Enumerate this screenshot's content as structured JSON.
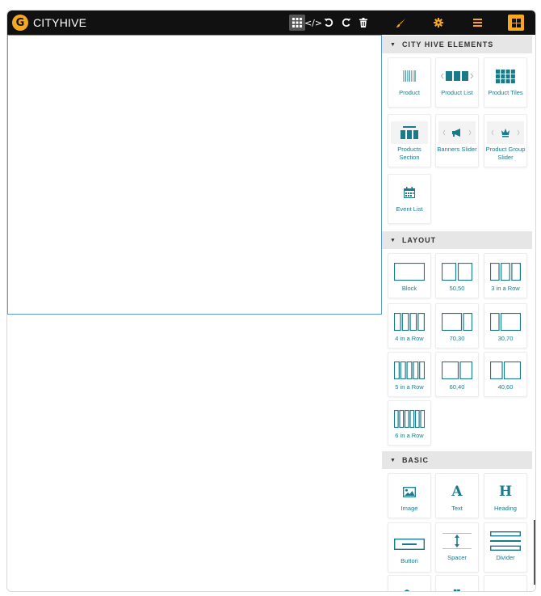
{
  "app": {
    "logo_letter": "G",
    "name": "CITYHIVE"
  },
  "toolbar": {
    "grid_icon": "grid-icon",
    "code_label": "</>",
    "undo_icon": "undo-icon",
    "redo_icon": "redo-icon",
    "trash_icon": "trash-icon",
    "brush_icon": "brush-icon",
    "gear_icon": "gear-icon",
    "menu_icon": "menu-icon",
    "blocks_icon": "blocks-icon"
  },
  "colors": {
    "accent": "#f7a823",
    "teal": "#1b7a8a",
    "topbar": "#111111",
    "selection_border": "#5b9bd5"
  },
  "sections": {
    "elements": {
      "title": "CITY HIVE ELEMENTS",
      "items": [
        {
          "label": "Product",
          "icon": "barcode-icon"
        },
        {
          "label": "Product List",
          "icon": "product-list-icon"
        },
        {
          "label": "Product Tiles",
          "icon": "product-tiles-icon"
        },
        {
          "label": "Products Section",
          "icon": "products-section-icon"
        },
        {
          "label": "Banners Slider",
          "icon": "megaphone-slider-icon"
        },
        {
          "label": "Product Group Slider",
          "icon": "crown-slider-icon"
        },
        {
          "label": "Event List",
          "icon": "calendar-icon"
        }
      ]
    },
    "layout": {
      "title": "LAYOUT",
      "items": [
        {
          "label": "Block",
          "icon": "block-layout-icon"
        },
        {
          "label": "50,50",
          "icon": "two-col-layout-icon"
        },
        {
          "label": "3 in a Row",
          "icon": "three-col-layout-icon"
        },
        {
          "label": "4 in a Row",
          "icon": "four-col-layout-icon"
        },
        {
          "label": "70,30",
          "icon": "seventy-thirty-layout-icon"
        },
        {
          "label": "30,70",
          "icon": "thirty-seventy-layout-icon"
        },
        {
          "label": "5 in a Row",
          "icon": "five-col-layout-icon"
        },
        {
          "label": "60,40",
          "icon": "sixty-forty-layout-icon"
        },
        {
          "label": "40,60",
          "icon": "forty-sixty-layout-icon"
        },
        {
          "label": "6 in a Row",
          "icon": "six-col-layout-icon"
        }
      ]
    },
    "basic": {
      "title": "BASIC",
      "items": [
        {
          "label": "Image",
          "icon": "image-icon"
        },
        {
          "label": "Text",
          "icon": "text-icon",
          "glyph": "A"
        },
        {
          "label": "Heading",
          "icon": "heading-icon",
          "glyph": "H"
        },
        {
          "label": "Button",
          "icon": "button-icon"
        },
        {
          "label": "Spacer",
          "icon": "spacer-icon"
        },
        {
          "label": "Divider",
          "icon": "divider-icon"
        },
        {
          "label": "",
          "icon": "link-icon"
        },
        {
          "label": "",
          "icon": "quote-icon",
          "glyph": "❞"
        },
        {
          "label": "",
          "icon": "code-icon",
          "glyph": "</>"
        }
      ]
    }
  }
}
